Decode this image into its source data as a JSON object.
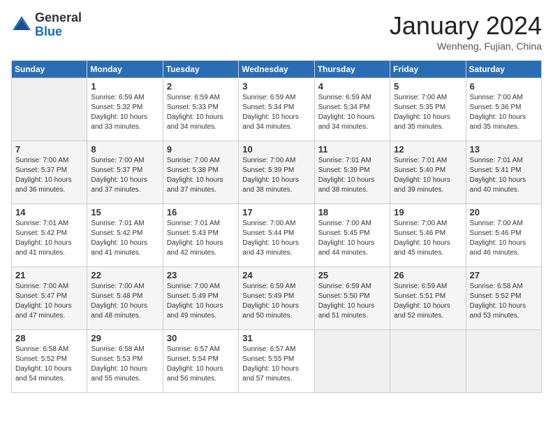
{
  "header": {
    "logo": {
      "general": "General",
      "blue": "Blue"
    },
    "title": "January 2024",
    "subtitle": "Wenheng, Fujian, China"
  },
  "weekdays": [
    "Sunday",
    "Monday",
    "Tuesday",
    "Wednesday",
    "Thursday",
    "Friday",
    "Saturday"
  ],
  "weeks": [
    [
      {
        "day": "",
        "sunrise": "",
        "sunset": "",
        "daylight": ""
      },
      {
        "day": "1",
        "sunrise": "Sunrise: 6:59 AM",
        "sunset": "Sunset: 5:32 PM",
        "daylight": "Daylight: 10 hours and 33 minutes."
      },
      {
        "day": "2",
        "sunrise": "Sunrise: 6:59 AM",
        "sunset": "Sunset: 5:33 PM",
        "daylight": "Daylight: 10 hours and 34 minutes."
      },
      {
        "day": "3",
        "sunrise": "Sunrise: 6:59 AM",
        "sunset": "Sunset: 5:34 PM",
        "daylight": "Daylight: 10 hours and 34 minutes."
      },
      {
        "day": "4",
        "sunrise": "Sunrise: 6:59 AM",
        "sunset": "Sunset: 5:34 PM",
        "daylight": "Daylight: 10 hours and 34 minutes."
      },
      {
        "day": "5",
        "sunrise": "Sunrise: 7:00 AM",
        "sunset": "Sunset: 5:35 PM",
        "daylight": "Daylight: 10 hours and 35 minutes."
      },
      {
        "day": "6",
        "sunrise": "Sunrise: 7:00 AM",
        "sunset": "Sunset: 5:36 PM",
        "daylight": "Daylight: 10 hours and 35 minutes."
      }
    ],
    [
      {
        "day": "7",
        "sunrise": "Sunrise: 7:00 AM",
        "sunset": "Sunset: 5:37 PM",
        "daylight": "Daylight: 10 hours and 36 minutes."
      },
      {
        "day": "8",
        "sunrise": "Sunrise: 7:00 AM",
        "sunset": "Sunset: 5:37 PM",
        "daylight": "Daylight: 10 hours and 37 minutes."
      },
      {
        "day": "9",
        "sunrise": "Sunrise: 7:00 AM",
        "sunset": "Sunset: 5:38 PM",
        "daylight": "Daylight: 10 hours and 37 minutes."
      },
      {
        "day": "10",
        "sunrise": "Sunrise: 7:00 AM",
        "sunset": "Sunset: 5:39 PM",
        "daylight": "Daylight: 10 hours and 38 minutes."
      },
      {
        "day": "11",
        "sunrise": "Sunrise: 7:01 AM",
        "sunset": "Sunset: 5:39 PM",
        "daylight": "Daylight: 10 hours and 38 minutes."
      },
      {
        "day": "12",
        "sunrise": "Sunrise: 7:01 AM",
        "sunset": "Sunset: 5:40 PM",
        "daylight": "Daylight: 10 hours and 39 minutes."
      },
      {
        "day": "13",
        "sunrise": "Sunrise: 7:01 AM",
        "sunset": "Sunset: 5:41 PM",
        "daylight": "Daylight: 10 hours and 40 minutes."
      }
    ],
    [
      {
        "day": "14",
        "sunrise": "Sunrise: 7:01 AM",
        "sunset": "Sunset: 5:42 PM",
        "daylight": "Daylight: 10 hours and 41 minutes."
      },
      {
        "day": "15",
        "sunrise": "Sunrise: 7:01 AM",
        "sunset": "Sunset: 5:42 PM",
        "daylight": "Daylight: 10 hours and 41 minutes."
      },
      {
        "day": "16",
        "sunrise": "Sunrise: 7:01 AM",
        "sunset": "Sunset: 5:43 PM",
        "daylight": "Daylight: 10 hours and 42 minutes."
      },
      {
        "day": "17",
        "sunrise": "Sunrise: 7:00 AM",
        "sunset": "Sunset: 5:44 PM",
        "daylight": "Daylight: 10 hours and 43 minutes."
      },
      {
        "day": "18",
        "sunrise": "Sunrise: 7:00 AM",
        "sunset": "Sunset: 5:45 PM",
        "daylight": "Daylight: 10 hours and 44 minutes."
      },
      {
        "day": "19",
        "sunrise": "Sunrise: 7:00 AM",
        "sunset": "Sunset: 5:46 PM",
        "daylight": "Daylight: 10 hours and 45 minutes."
      },
      {
        "day": "20",
        "sunrise": "Sunrise: 7:00 AM",
        "sunset": "Sunset: 5:46 PM",
        "daylight": "Daylight: 10 hours and 46 minutes."
      }
    ],
    [
      {
        "day": "21",
        "sunrise": "Sunrise: 7:00 AM",
        "sunset": "Sunset: 5:47 PM",
        "daylight": "Daylight: 10 hours and 47 minutes."
      },
      {
        "day": "22",
        "sunrise": "Sunrise: 7:00 AM",
        "sunset": "Sunset: 5:48 PM",
        "daylight": "Daylight: 10 hours and 48 minutes."
      },
      {
        "day": "23",
        "sunrise": "Sunrise: 7:00 AM",
        "sunset": "Sunset: 5:49 PM",
        "daylight": "Daylight: 10 hours and 49 minutes."
      },
      {
        "day": "24",
        "sunrise": "Sunrise: 6:59 AM",
        "sunset": "Sunset: 5:49 PM",
        "daylight": "Daylight: 10 hours and 50 minutes."
      },
      {
        "day": "25",
        "sunrise": "Sunrise: 6:59 AM",
        "sunset": "Sunset: 5:50 PM",
        "daylight": "Daylight: 10 hours and 51 minutes."
      },
      {
        "day": "26",
        "sunrise": "Sunrise: 6:59 AM",
        "sunset": "Sunset: 5:51 PM",
        "daylight": "Daylight: 10 hours and 52 minutes."
      },
      {
        "day": "27",
        "sunrise": "Sunrise: 6:58 AM",
        "sunset": "Sunset: 5:52 PM",
        "daylight": "Daylight: 10 hours and 53 minutes."
      }
    ],
    [
      {
        "day": "28",
        "sunrise": "Sunrise: 6:58 AM",
        "sunset": "Sunset: 5:52 PM",
        "daylight": "Daylight: 10 hours and 54 minutes."
      },
      {
        "day": "29",
        "sunrise": "Sunrise: 6:58 AM",
        "sunset": "Sunset: 5:53 PM",
        "daylight": "Daylight: 10 hours and 55 minutes."
      },
      {
        "day": "30",
        "sunrise": "Sunrise: 6:57 AM",
        "sunset": "Sunset: 5:54 PM",
        "daylight": "Daylight: 10 hours and 56 minutes."
      },
      {
        "day": "31",
        "sunrise": "Sunrise: 6:57 AM",
        "sunset": "Sunset: 5:55 PM",
        "daylight": "Daylight: 10 hours and 57 minutes."
      },
      {
        "day": "",
        "sunrise": "",
        "sunset": "",
        "daylight": ""
      },
      {
        "day": "",
        "sunrise": "",
        "sunset": "",
        "daylight": ""
      },
      {
        "day": "",
        "sunrise": "",
        "sunset": "",
        "daylight": ""
      }
    ]
  ]
}
